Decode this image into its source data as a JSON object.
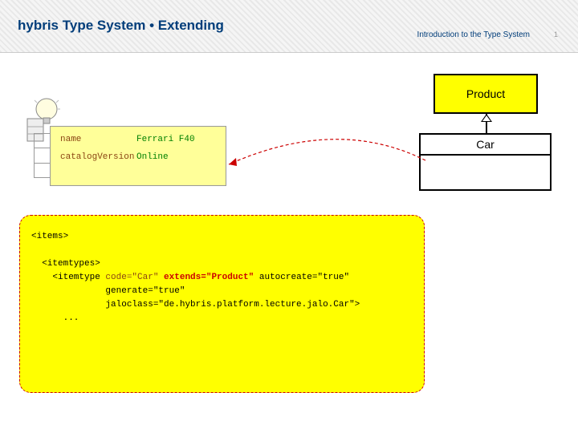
{
  "header": {
    "title": "hybris Type System • Extending",
    "subtitle": "Introduction to the Type System",
    "page_number": "1"
  },
  "uml": {
    "product_label": "Product",
    "car_label": "Car"
  },
  "instance": {
    "field1_key": "name",
    "field1_val": "Ferrari F40",
    "field2_key": "catalogVersion",
    "field2_val": "Online"
  },
  "code": {
    "l1": "<items>",
    "l2": "<itemtypes>",
    "l3a": "<itemtype ",
    "l3b": "code=\"Car\"",
    "l3c": " extends=\"Product\"",
    "l3d": " autocreate=\"true\"",
    "l4": "generate=\"true\"",
    "l5": "jaloclass=\"de.hybris.platform.lecture.jalo.Car\">",
    "l6": "..."
  }
}
